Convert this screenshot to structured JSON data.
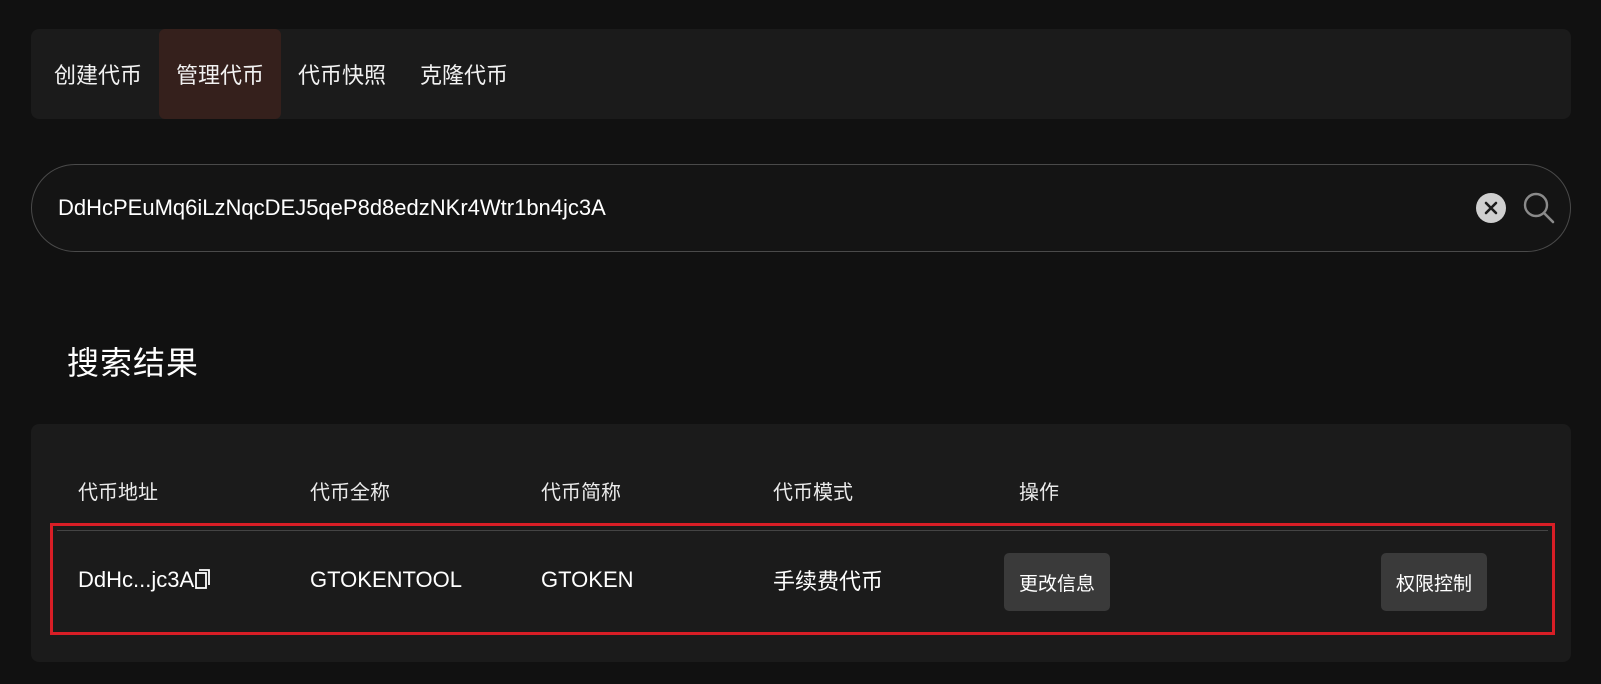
{
  "tabs": [
    {
      "label": "创建代币",
      "active": false
    },
    {
      "label": "管理代币",
      "active": true
    },
    {
      "label": "代币快照",
      "active": false
    },
    {
      "label": "克隆代币",
      "active": false
    }
  ],
  "search": {
    "value": "DdHcPEuMq6iLzNqcDEJ5qeP8d8edzNKr4Wtr1bn4jc3A",
    "clear_icon": "clear-icon",
    "search_icon": "search-icon"
  },
  "results": {
    "title": "搜索结果",
    "columns": [
      "代币地址",
      "代币全称",
      "代币简称",
      "代币模式",
      "操作"
    ],
    "rows": [
      {
        "address": "DdHc...jc3A",
        "full_name": "GTOKENTOOL",
        "symbol": "GTOKEN",
        "mode": "手续费代币",
        "actions": [
          "更改信息",
          "权限控制"
        ]
      }
    ]
  },
  "colors": {
    "background": "#111111",
    "panel": "#1b1b1b",
    "active_tab": "#35201c",
    "highlight_border": "#d81e26",
    "button": "#3a3a3a"
  }
}
